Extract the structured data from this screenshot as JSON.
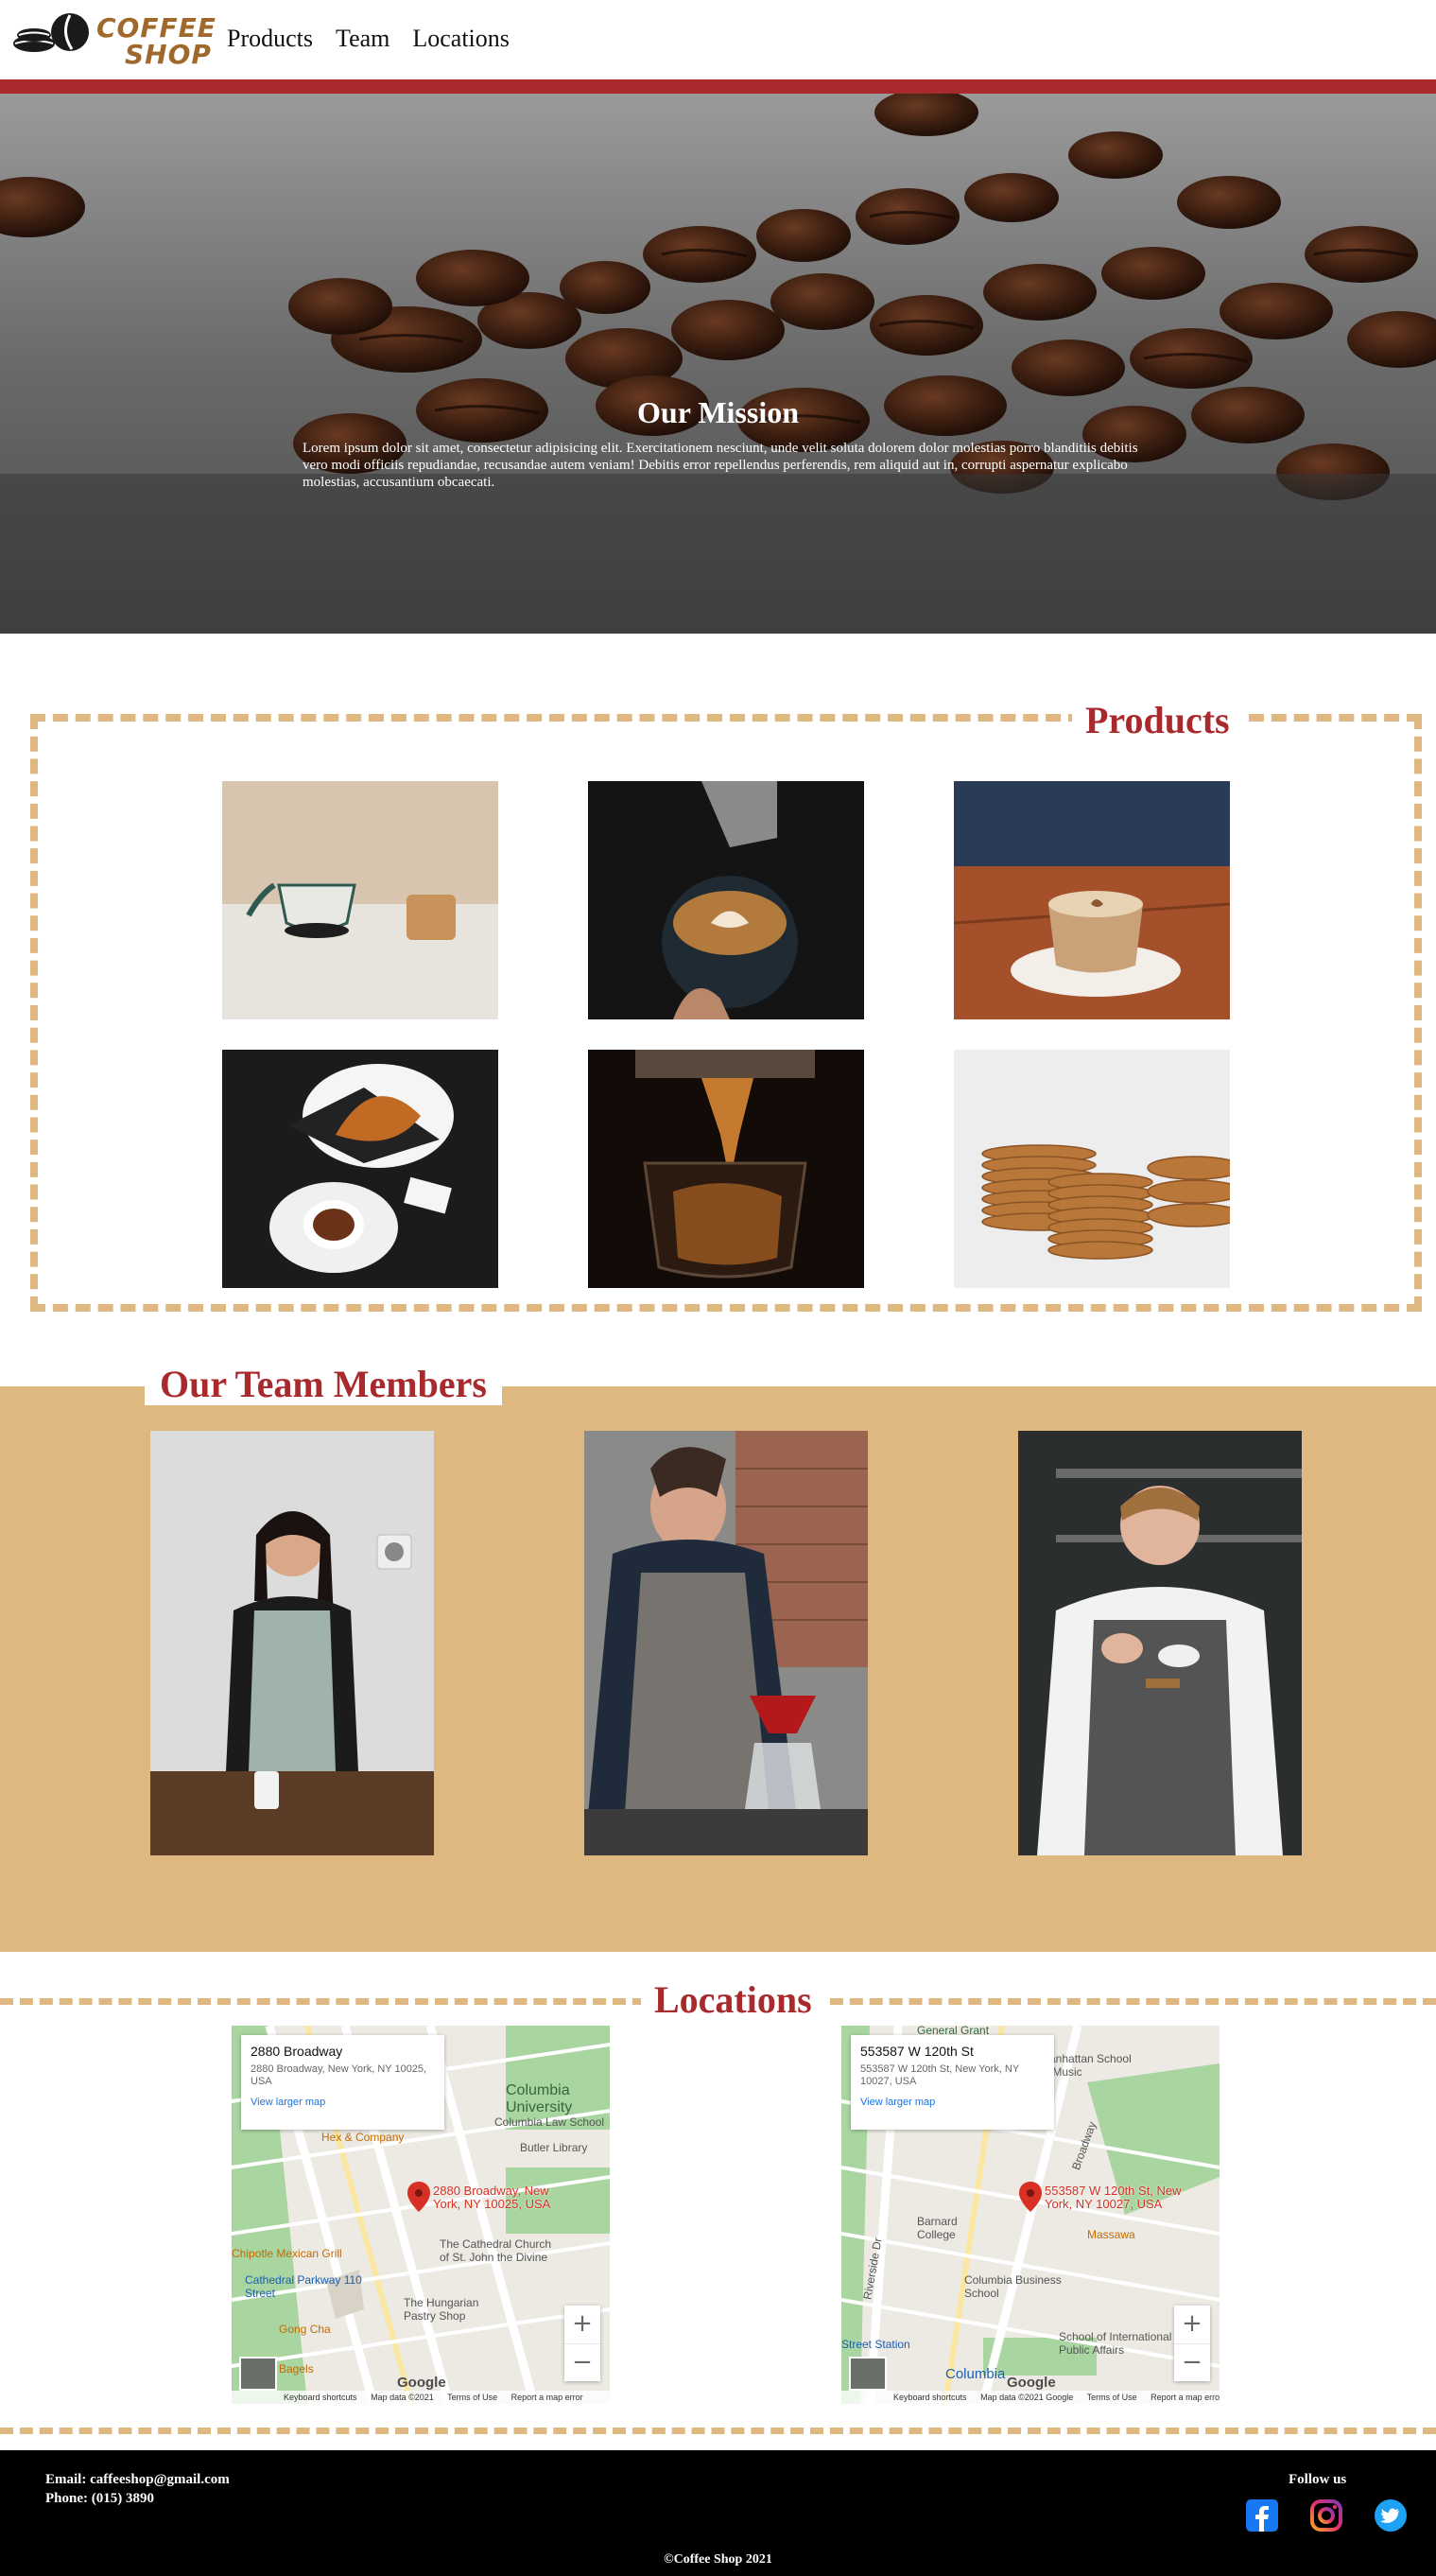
{
  "header": {
    "logo": {
      "line1": "COFFEE",
      "line2": "SHOP",
      "icon": "coffee-bean-icon"
    },
    "nav": [
      "Products",
      "Team",
      "Locations"
    ]
  },
  "colors": {
    "accent_red": "#a82a2d",
    "sand": "#dfb781",
    "footer_bg": "#000000"
  },
  "hero": {
    "title": "Our Mission",
    "text": "Lorem ipsum dolor sit amet, consectetur adipisicing elit. Exercitationem nesciunt, unde velit soluta dolorem dolor molestias porro blanditiis debitis vero modi officiis repudiandae, recusandae autem veniam! Debitis error repellendus perferendis, rem aliquid aut in, corrupti aspernatur explicabo molestias, accusantium obcaecati."
  },
  "products": {
    "title": "Products",
    "items": [
      "coffee-dripper-photo",
      "latte-art-pour-photo",
      "cappuccino-cup-photo",
      "croissant-and-coffee-photo",
      "espresso-extraction-photo",
      "cookie-stack-photo"
    ]
  },
  "team": {
    "title": "Our Team Members",
    "members": [
      "barista-woman-apron-photo",
      "barista-pour-over-photo",
      "barista-man-cup-photo"
    ]
  },
  "locations": {
    "title": "Locations",
    "maps": [
      {
        "card_title": "2880 Broadway",
        "card_address": "2880 Broadway, New York, NY 10025, USA",
        "view_larger": "View larger map",
        "pin_label": "2880 Broadway, New York, NY 10025, USA",
        "labels": [
          "Columbia University",
          "Columbia Law School",
          "Butler Library",
          "Hex & Company",
          "The Cathedral Church of St. John the Divine",
          "Cathedral Parkway 110 Street",
          "The Hungarian Pastry Shop",
          "Gong Cha",
          "Bagels",
          "Chipotle Mexican Grill"
        ],
        "footer": [
          "Keyboard shortcuts",
          "Map data ©2021",
          "Terms of Use",
          "Report a map error"
        ],
        "google": "Google"
      },
      {
        "card_title": "553587 W 120th St",
        "card_address": "553587 W 120th St, New York, NY 10027, USA",
        "view_larger": "View larger map",
        "pin_label": "553587 W 120th St, New York, NY 10027, USA",
        "labels": [
          "General Grant",
          "Manhattan School of Music",
          "Barnard College",
          "Columbia Business School",
          "Massawa",
          "School of International and Public Affairs",
          "Street Station",
          "Columbia",
          "Riverside Dr",
          "Broadway"
        ],
        "footer": [
          "Keyboard shortcuts",
          "Map data ©2021 Google",
          "Terms of Use",
          "Report a map error"
        ],
        "google": "Google"
      }
    ]
  },
  "footer": {
    "email": "Email: caffeeshop@gmail.com",
    "phone": "Phone: (015) 3890",
    "follow": "Follow us",
    "social": [
      "facebook-icon",
      "instagram-icon",
      "twitter-icon"
    ],
    "copyright": "©Coffee Shop 2021"
  }
}
